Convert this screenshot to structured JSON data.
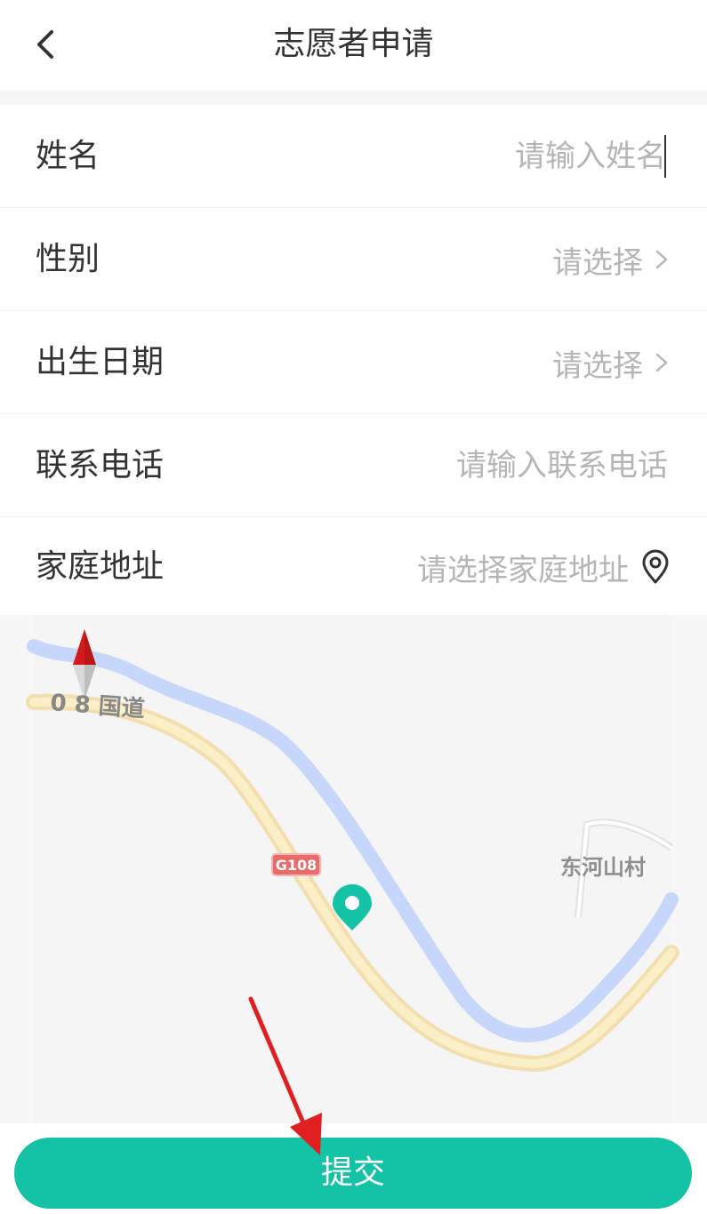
{
  "header": {
    "title": "志愿者申请",
    "back_icon": "chevron-left-icon"
  },
  "form": {
    "name": {
      "label": "姓名",
      "placeholder": "请输入姓名",
      "value": ""
    },
    "gender": {
      "label": "性别",
      "placeholder": "请选择"
    },
    "birthdate": {
      "label": "出生日期",
      "placeholder": "请选择"
    },
    "phone": {
      "label": "联系电话",
      "placeholder": "请输入联系电话",
      "value": ""
    },
    "address": {
      "label": "家庭地址",
      "placeholder": "请选择家庭地址",
      "icon": "location-pin-icon"
    }
  },
  "map": {
    "road_label": "0 8 国道",
    "road_shield": "G108",
    "village_label": "东河山村",
    "marker_color": "#14c2a6"
  },
  "submit": {
    "label": "提交"
  },
  "colors": {
    "accent": "#14c2a6",
    "placeholder": "#b5b5b5",
    "text": "#333333",
    "annotation_arrow": "#e02020"
  }
}
